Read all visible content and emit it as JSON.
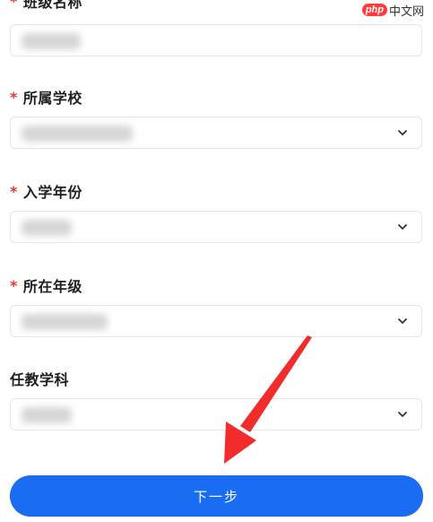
{
  "watermark": {
    "badge": "php",
    "text": "中文网"
  },
  "form": {
    "class_name": {
      "label": "班级名称",
      "required": true
    },
    "school": {
      "label": "所属学校",
      "required": true
    },
    "enroll_year": {
      "label": "入学年份",
      "required": true
    },
    "grade": {
      "label": "所在年级",
      "required": true
    },
    "subject": {
      "label": "任教学科",
      "required": false
    }
  },
  "required_mark": "*",
  "next_button_label": "下一步",
  "colors": {
    "primary": "#1a6cf2",
    "required": "#e5333a",
    "arrow": "#f22b2b"
  },
  "icons": {
    "dropdown": "chevron-down-icon"
  }
}
